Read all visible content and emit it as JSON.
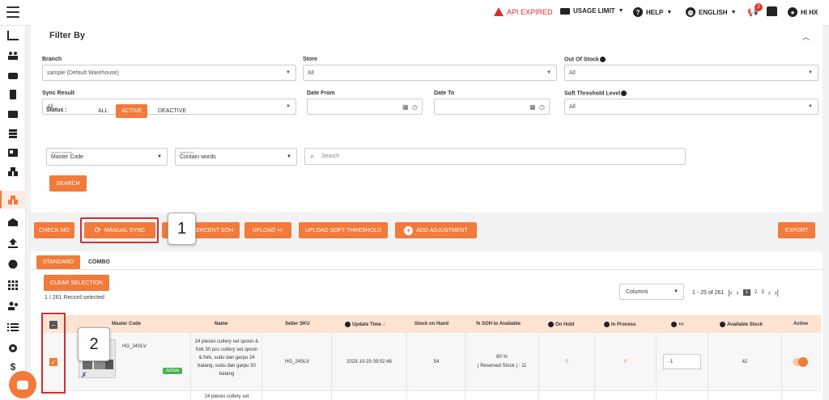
{
  "topbar": {
    "api_status": "API EXPIRED",
    "usage_limit": "USAGE LIMIT",
    "help": "HELP",
    "language": "ENGLISH",
    "notification_count": "1",
    "user": "HI HX"
  },
  "filter": {
    "title": "Filter By",
    "branch_label": "Branch",
    "branch_value": "sample (Default Warehouse)",
    "store_label": "Store",
    "store_value": "All",
    "out_of_stock_label": "Out Of Stock",
    "out_of_stock_value": "All",
    "sync_result_label": "Sync Result",
    "sync_result_value": "All",
    "date_from_label": "Date From",
    "date_to_label": "Date To",
    "soft_threshold_label": "Soft Threshold Level",
    "soft_threshold_value": "All",
    "status_label": "Status :",
    "status_tabs": [
      "ALL",
      "ACTIVE",
      "DEACTIVE"
    ],
    "search_column_sub": "search column",
    "search_column_value": "Master Code",
    "search_by_sub": "search by",
    "search_by_value": "Contain words",
    "search_placeholder": "Search",
    "search_button": "SEARCH"
  },
  "actions": {
    "check_mo": "CHECK MO",
    "manual_sync": "MANUAL SYNC",
    "percent_soh": "PERCENT SOH",
    "upload_plus_minus": "UPLOAD +/-",
    "upload_soft_threshold": "UPLOAD SOFT THRESHOLD",
    "add_adjustment": "ADD ADJUSTMENT",
    "export": "EXPORT"
  },
  "callouts": [
    "1",
    "2"
  ],
  "table": {
    "tabs": [
      "STANDARD",
      "COMBO"
    ],
    "clear_selection": "CLEAR SELECTION",
    "record_selected": "1 / 261 Record selected",
    "columns_label": "Columns",
    "pagination": {
      "range": "1 - 25 of 261",
      "pages": [
        "1",
        "2",
        "3"
      ]
    },
    "headers": [
      "Master Code",
      "Name",
      "Seller SKU",
      "Update Time",
      "Stock on Hand",
      "% SOH to Available",
      "On Hold",
      "In Process",
      "+/-",
      "Available Stock",
      "Active"
    ],
    "rows": [
      {
        "master_code": "HG_24SLV",
        "status_tag": "Active",
        "name": "24 pieces cutlery set spoon & fork 30 pcs cutlery set spoon & fork, sudu dan garpu 24 batang, sudu dan garpu 30 batang",
        "seller_sku": "HG_24SLV",
        "update_time": "2023-10-25 09:02:46",
        "stock_on_hand": "54",
        "soh_percent": "80 %",
        "reserved_stock": "( Reserved Stock ) : 11",
        "on_hold": "0",
        "in_process": "0",
        "plus_minus": "-1",
        "available_stock": "42"
      },
      {
        "name": "24 pieces cutlery set"
      }
    ]
  },
  "colors": {
    "accent": "#f27a3a",
    "highlight_red": "#d32f2f",
    "header_bg": "#fde3d2",
    "active_green": "#4caf50"
  }
}
